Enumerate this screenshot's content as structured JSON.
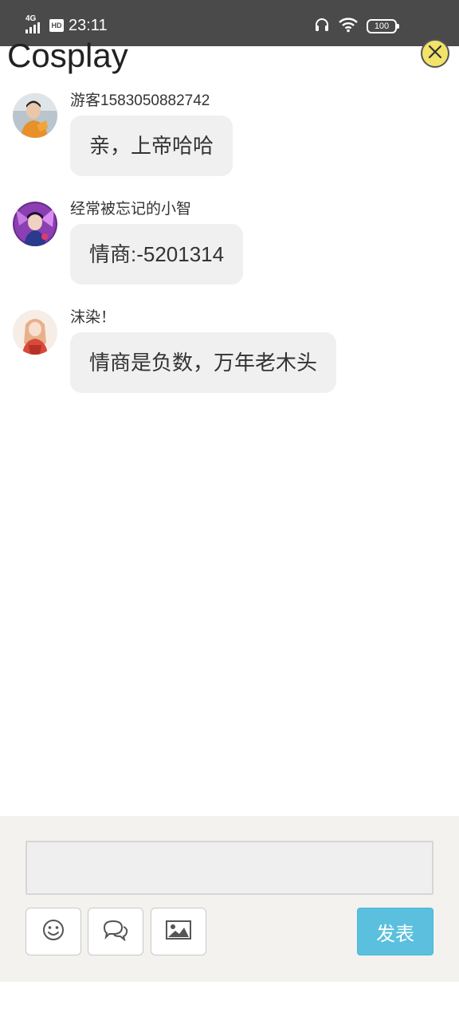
{
  "status_bar": {
    "network": "4G",
    "hd": "HD",
    "time": "23:11",
    "battery": "100"
  },
  "header": {
    "title": "Cosplay"
  },
  "messages": [
    {
      "username": "游客1583050882742",
      "text": "亲，上帝哈哈",
      "avatar": "avatar-user-1"
    },
    {
      "username": "经常被忘记的小智",
      "text": "情商:-5201314",
      "avatar": "avatar-user-2"
    },
    {
      "username": "沫染！",
      "text": "情商是负数，万年老木头",
      "avatar": "avatar-user-3"
    }
  ],
  "composer": {
    "input_value": "",
    "input_placeholder": "",
    "send_label": "发表",
    "tools": [
      "emoji-icon",
      "comment-icon",
      "image-icon"
    ]
  },
  "colors": {
    "send_button": "#5bc0de",
    "close_button": "#f2e36a",
    "bubble": "#f0f0f0",
    "composer_bg": "#f3f2ee",
    "status_bar": "#4a4a4a"
  }
}
